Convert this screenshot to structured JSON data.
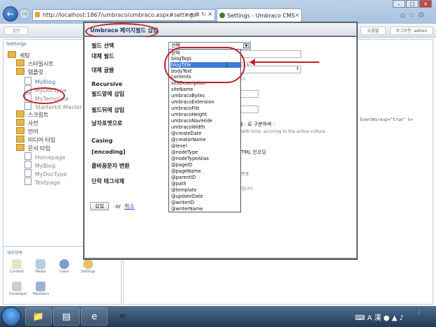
{
  "browser": {
    "url": "http://localhost:1867/umbraco/umbraco.aspx#settings",
    "tab_title": "Settings - Umbraco CMS -...",
    "tab_close": "×"
  },
  "app": {
    "top_left_button": "설정",
    "top_right_button_1": "도움말",
    "top_right_button_2": "로그아웃: admin"
  },
  "sidebar": {
    "title": "Settings",
    "items": [
      {
        "label": "세팅",
        "icon": "folder-icon"
      },
      {
        "label": "스타일시트",
        "icon": "folder-icon"
      },
      {
        "label": "템플릿",
        "icon": "folder-icon"
      },
      {
        "label": "MyBlog",
        "icon": "document-icon"
      },
      {
        "label": "MyDocType",
        "icon": "document-icon"
      },
      {
        "label": "MyTemplate",
        "icon": "document-icon"
      },
      {
        "label": "Starterkit Master",
        "icon": "document-icon"
      },
      {
        "label": "스크립트",
        "icon": "folder-icon"
      },
      {
        "label": "사전",
        "icon": "folder-icon"
      },
      {
        "label": "언어",
        "icon": "folder-icon"
      },
      {
        "label": "미디어 타입",
        "icon": "folder-icon"
      },
      {
        "label": "문서 타입",
        "icon": "folder-icon"
      },
      {
        "label": "Homepage",
        "icon": "document-icon"
      },
      {
        "label": "MyBlog",
        "icon": "document-icon"
      },
      {
        "label": "MyDocType",
        "icon": "document-icon"
      },
      {
        "label": "Textpage",
        "icon": "document-icon"
      }
    ]
  },
  "sections": {
    "title": "세부항목",
    "items": [
      {
        "label": "Content"
      },
      {
        "label": "Media"
      },
      {
        "label": "Users"
      },
      {
        "label": "Settings"
      },
      {
        "label": "Developer"
      },
      {
        "label": "Members"
      }
    ]
  },
  "main": {
    "code_snippet": "EventWireup=\"true\" %>"
  },
  "modal": {
    "title": "Umbraco 페이지필드 삽입",
    "labels": {
      "field_select": "필드 선택",
      "alt_field": "대체 필드",
      "alt_text": "대체 글쓸",
      "recursive": "Recursive",
      "insert_before": "필드앞에 삽입",
      "insert_after": "필드뒤에 삽입",
      "date_format": "날자포맷으로",
      "casing": "Casing",
      "encoding": "[encoding]",
      "linebreak": "줄바꿈문자 변환",
      "strip_tags": "단락 태그삭제"
    },
    "select_value": "선택",
    "partial_notes": {
      "n1": "드 값",
      "n2": "다.",
      "date_sep": "체  : 로 구분하며 :",
      "date_note": "with time, accoring to the active culture.",
      "encoding_note": "TML 인코딩",
      "linebreak_note": "변경",
      "strip_note": "입니다"
    },
    "dropdown_options": [
      "선택",
      "blogTags",
      "blogTitle",
      "bodyText",
      "contents",
      "siteDescription",
      "siteName",
      "umbracoBytes",
      "umbracoExtension",
      "umbracoFile",
      "umbracoHeight",
      "umbracoNaviHide",
      "umbracoWidth",
      "@createDate",
      "@creatorName",
      "@level",
      "@nodeType",
      "@nodeTypeAlias",
      "@pageID",
      "@pageName",
      "@parentID",
      "@path",
      "@template",
      "@updateDate",
      "@writerID",
      "@writerName"
    ],
    "selected_option": "blogTitle",
    "insert_button": "삽입",
    "or_text": "or",
    "cancel_link": "취소"
  },
  "colors": {
    "annotation": "#c0202a",
    "selection": "#3a7bd5"
  }
}
